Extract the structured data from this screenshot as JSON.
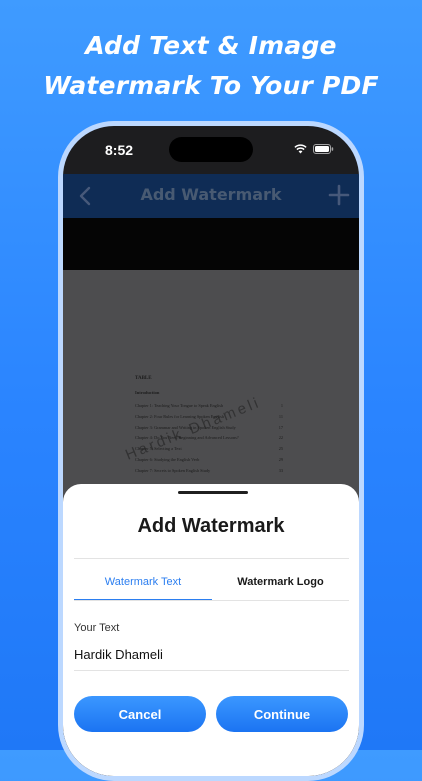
{
  "promo": {
    "line1": "Add Text & Image",
    "line2": "Watermark To Your PDF"
  },
  "status_bar": {
    "time": "8:52",
    "icons": [
      "wifi-icon",
      "battery-icon"
    ]
  },
  "navbar": {
    "title": "Add Watermark",
    "back_icon": "chevron-left-icon",
    "add_icon": "plus-icon"
  },
  "document": {
    "heading": "TABLE",
    "intro": "Introduction",
    "toc": [
      {
        "title": "Chapter 1: Teaching Your Tongue to Speak English",
        "page": "1"
      },
      {
        "title": "Chapter 2: Four Rules for Learning Spoken English",
        "page": "11"
      },
      {
        "title": "Chapter 3: Grammar and Writing in Spoken English Study",
        "page": "17"
      },
      {
        "title": "Chapter 4: Do You Need Beginning and Advanced Lessons?",
        "page": "22"
      },
      {
        "title": "Chapter 5: Selecting a Text",
        "page": "25"
      },
      {
        "title": "Chapter 6: Studying the English Verb",
        "page": "29"
      },
      {
        "title": "Chapter 7: Secrets to Spoken English Study",
        "page": "33"
      }
    ],
    "watermark_text": "Hardik Dhameli"
  },
  "sheet": {
    "title": "Add Watermark",
    "tabs": [
      {
        "label": "Watermark Text",
        "active": true
      },
      {
        "label": "Watermark Logo",
        "active": false
      }
    ],
    "field_label": "Your Text",
    "field_value": "Hardik Dhameli",
    "cancel_label": "Cancel",
    "continue_label": "Continue"
  },
  "colors": {
    "background": "#2a84ff",
    "accent": "#2b7ef0",
    "navbar": "#0f2c55"
  }
}
